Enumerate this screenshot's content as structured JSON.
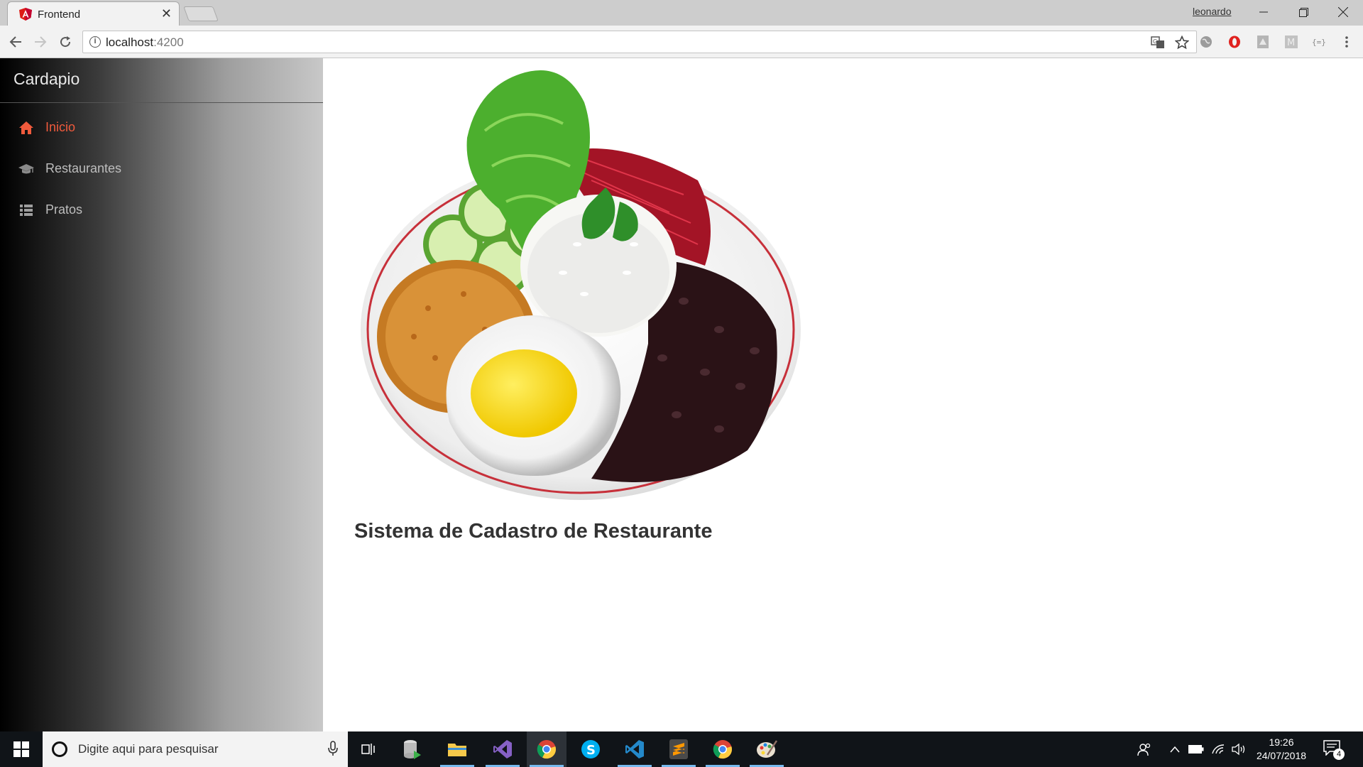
{
  "browser": {
    "tab_title": "Frontend",
    "profile_name": "leonardo",
    "url_host": "localhost",
    "url_port": ":4200"
  },
  "sidebar": {
    "brand": "Cardapio",
    "items": [
      {
        "label": "Inicio",
        "icon": "home-icon",
        "active": true
      },
      {
        "label": "Restaurantes",
        "icon": "graduation-cap-icon",
        "active": false
      },
      {
        "label": "Pratos",
        "icon": "list-icon",
        "active": false
      }
    ]
  },
  "main": {
    "title": "Sistema de Cadastro de Restaurante"
  },
  "taskbar": {
    "search_placeholder": "Digite aqui para pesquisar",
    "time": "19:26",
    "date": "24/07/2018",
    "notification_count": "4"
  },
  "colors": {
    "accent": "#f05a3c",
    "sidebar_dark": "#000000",
    "sidebar_light": "#c8c8c8",
    "taskbar": "#101418"
  }
}
